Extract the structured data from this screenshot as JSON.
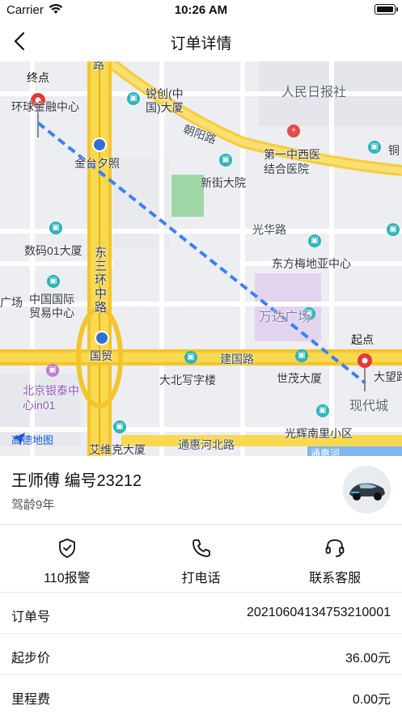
{
  "status_bar": {
    "carrier": "Carrier",
    "time": "10:26 AM"
  },
  "nav": {
    "title": "订单详情"
  },
  "map": {
    "labels": {
      "end": "终点",
      "start": "起点",
      "ifc": "环球金融中心",
      "ruichuang": "锐创(中国)大厦",
      "renmin": "人民日报社",
      "chaoyang_road": "朝阳路",
      "hospital": "第一中西医结合医院",
      "tong": "铜",
      "jintai": "金台夕照",
      "xinjie": "新街大院",
      "guanghua": "光华路",
      "dongfang": "东方梅地亚中心",
      "shuma": "数码01大厦",
      "third_ring": "东三环中路",
      "trade": "中国国际贸易中心",
      "guang": "广场",
      "wanda": "万达广场",
      "guomao": "国贸",
      "jianguo": "建国路",
      "dabei": "大北写字楼",
      "shimao": "世茂大厦",
      "dawang": "大望路",
      "yintai": "北京银泰中心in01",
      "xiandai": "现代城",
      "guanghui": "光辉南里小区",
      "aiweike": "艾维克大厦",
      "tonghui": "通惠河北路",
      "tonghui_river": "通惠河",
      "road_top": "路",
      "logo": "高德地图"
    },
    "route_color": "#3b82f0"
  },
  "driver": {
    "name": "王师傅 编号23212",
    "driving_years": "驾龄9年"
  },
  "actions": [
    {
      "label": "110报警",
      "icon": "shield-check-icon"
    },
    {
      "label": "打电话",
      "icon": "phone-icon"
    },
    {
      "label": "联系客服",
      "icon": "headset-icon"
    }
  ],
  "order": {
    "rows": [
      {
        "key": "订单号",
        "value": "20210604134753210001"
      },
      {
        "key": "起步价",
        "value": "36.00元"
      },
      {
        "key": "里程费",
        "value": "0.00元"
      }
    ]
  }
}
